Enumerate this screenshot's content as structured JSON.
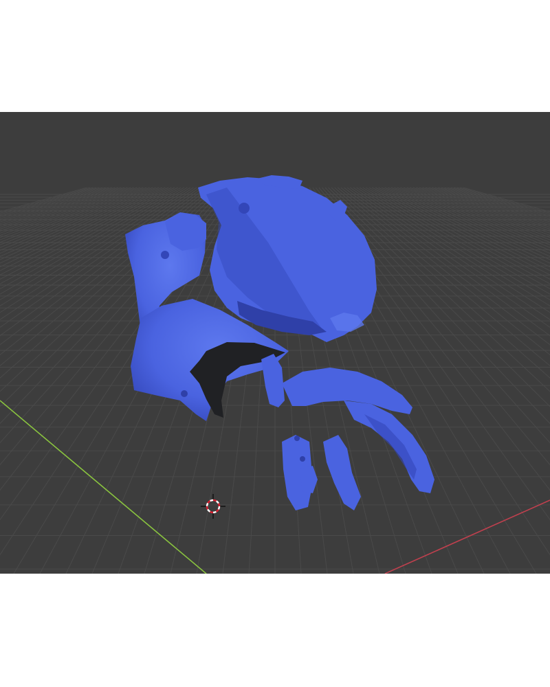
{
  "viewport": {
    "background": "#3d3d3d",
    "grid_color": "#4a4a4a",
    "x_axis_color": "#c0404e",
    "y_axis_color": "#8ac43f",
    "mesh_color": "#4a63e0",
    "mesh_shadow": "#3346b8",
    "mesh_highlight": "#5d78ee",
    "dark_part_color": "#202124",
    "cursor_icon": "3d-cursor-icon"
  }
}
